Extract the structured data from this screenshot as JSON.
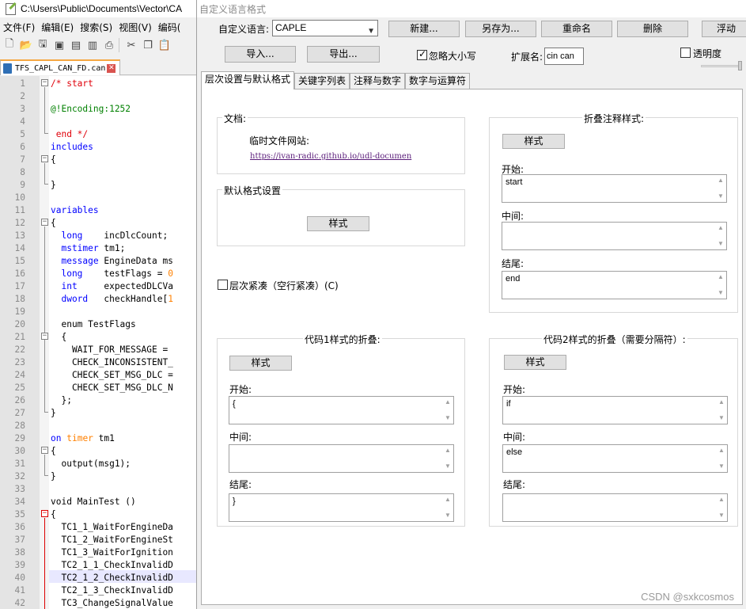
{
  "npp": {
    "title": "C:\\Users\\Public\\Documents\\Vector\\CA",
    "menu": [
      "文件(F)",
      "编辑(E)",
      "搜索(S)",
      "视图(V)",
      "编码("
    ],
    "tab_label": "TFS_CAPL_CAN_FD.can",
    "tab_close": "✕",
    "line_numbers": [
      "1",
      "2",
      "3",
      "4",
      "5",
      "6",
      "7",
      "8",
      "9",
      "10",
      "11",
      "12",
      "13",
      "14",
      "15",
      "16",
      "17",
      "18",
      "19",
      "20",
      "21",
      "22",
      "23",
      "24",
      "25",
      "26",
      "27",
      "28",
      "29",
      "30",
      "31",
      "32",
      "33",
      "34",
      "35",
      "36",
      "37",
      "38",
      "39",
      "40",
      "41",
      "42"
    ],
    "code": {
      "l1": "/* start",
      "l3": "@!Encoding:1252",
      "l5": " end */",
      "l6": "includes",
      "l7": "{",
      "l9": "}",
      "l11": "variables",
      "l12": "{",
      "l13a": "  long",
      "l13b": "    incDlcCount;",
      "l14a": "  mstimer",
      "l14b": " tm1;",
      "l15a": "  message",
      "l15b": " EngineData ms",
      "l16a": "  long",
      "l16b": "    testFlags = ",
      "l16c": "0",
      "l17a": "  int",
      "l17b": "     expectedDLCVa",
      "l18a": "  dword",
      "l18b": "   checkHandle[",
      "l18c": "1",
      "l20": "  enum TestFlags",
      "l21": "  {",
      "l22": "    WAIT_FOR_MESSAGE =",
      "l23": "    CHECK_INCONSISTENT_",
      "l24": "    CHECK_SET_MSG_DLC =",
      "l25": "    CHECK_SET_MSG_DLC_N",
      "l26": "  };",
      "l27": "}",
      "l29a": "on",
      "l29b": "timer",
      "l29c": " tm1",
      "l30": "{",
      "l31": "  output(msg1);",
      "l32": "}",
      "l34": "void MainTest ()",
      "l35": "{",
      "l36": "  TC1_1_WaitForEngineDa",
      "l37": "  TC1_2_WaitForEngineSt",
      "l38": "  TC1_3_WaitForIgnition",
      "l39": "  TC2_1_1_CheckInvalidD",
      "l40": "  TC2_1_2_CheckInvalidD",
      "l41": "  TC2_1_3_CheckInvalidD",
      "l42": "  TC3_ChangeSignalValue"
    }
  },
  "dialog": {
    "title": "自定义语言格式",
    "lang_label": "自定义语言:",
    "lang_value": "CAPLE",
    "btn_new": "新建...",
    "btn_saveas": "另存为...",
    "btn_rename": "重命名",
    "btn_delete": "删除",
    "btn_float": "浮动",
    "btn_import": "导入...",
    "btn_export": "导出...",
    "ignore_case_label": "忽略大小写",
    "ignore_case_checked": true,
    "ext_label": "扩展名:",
    "ext_value": "cin can",
    "transparency_label": "透明度",
    "transparency_checked": false,
    "tabs": [
      "层次设置与默认格式",
      "关键字列表",
      "注释与数字",
      "数字与运算符"
    ],
    "doc_group_title": "文档:",
    "temp_site_label": "临时文件网站:",
    "temp_site_url": "https://ivan-radic.github.io/udl-documen",
    "default_style_group_title": "默认格式设置",
    "style_button": "样式",
    "compact_label": "层次紧凑（空行紧凑）(C)",
    "compact_checked": false,
    "fold_comment_group_title": "折叠注释样式:",
    "start_label": "开始:",
    "middle_label": "中间:",
    "end_label": "结尾:",
    "fold_comment_start": "start",
    "fold_comment_middle": "",
    "fold_comment_end": "end",
    "code1_group_title": "代码1样式的折叠:",
    "code1_start": "{",
    "code1_middle": "",
    "code1_end": "}",
    "code2_group_title": "代码2样式的折叠（需要分隔符）:",
    "code2_start": "if",
    "code2_middle": "else",
    "code2_end": ""
  },
  "watermark": "CSDN @sxkcosmos",
  "colors": {
    "keyword": "#0000ff",
    "keyword2": "#8000ff",
    "comment": "#e0000a",
    "number": "#ff8000",
    "link": "#5a1c7a"
  }
}
